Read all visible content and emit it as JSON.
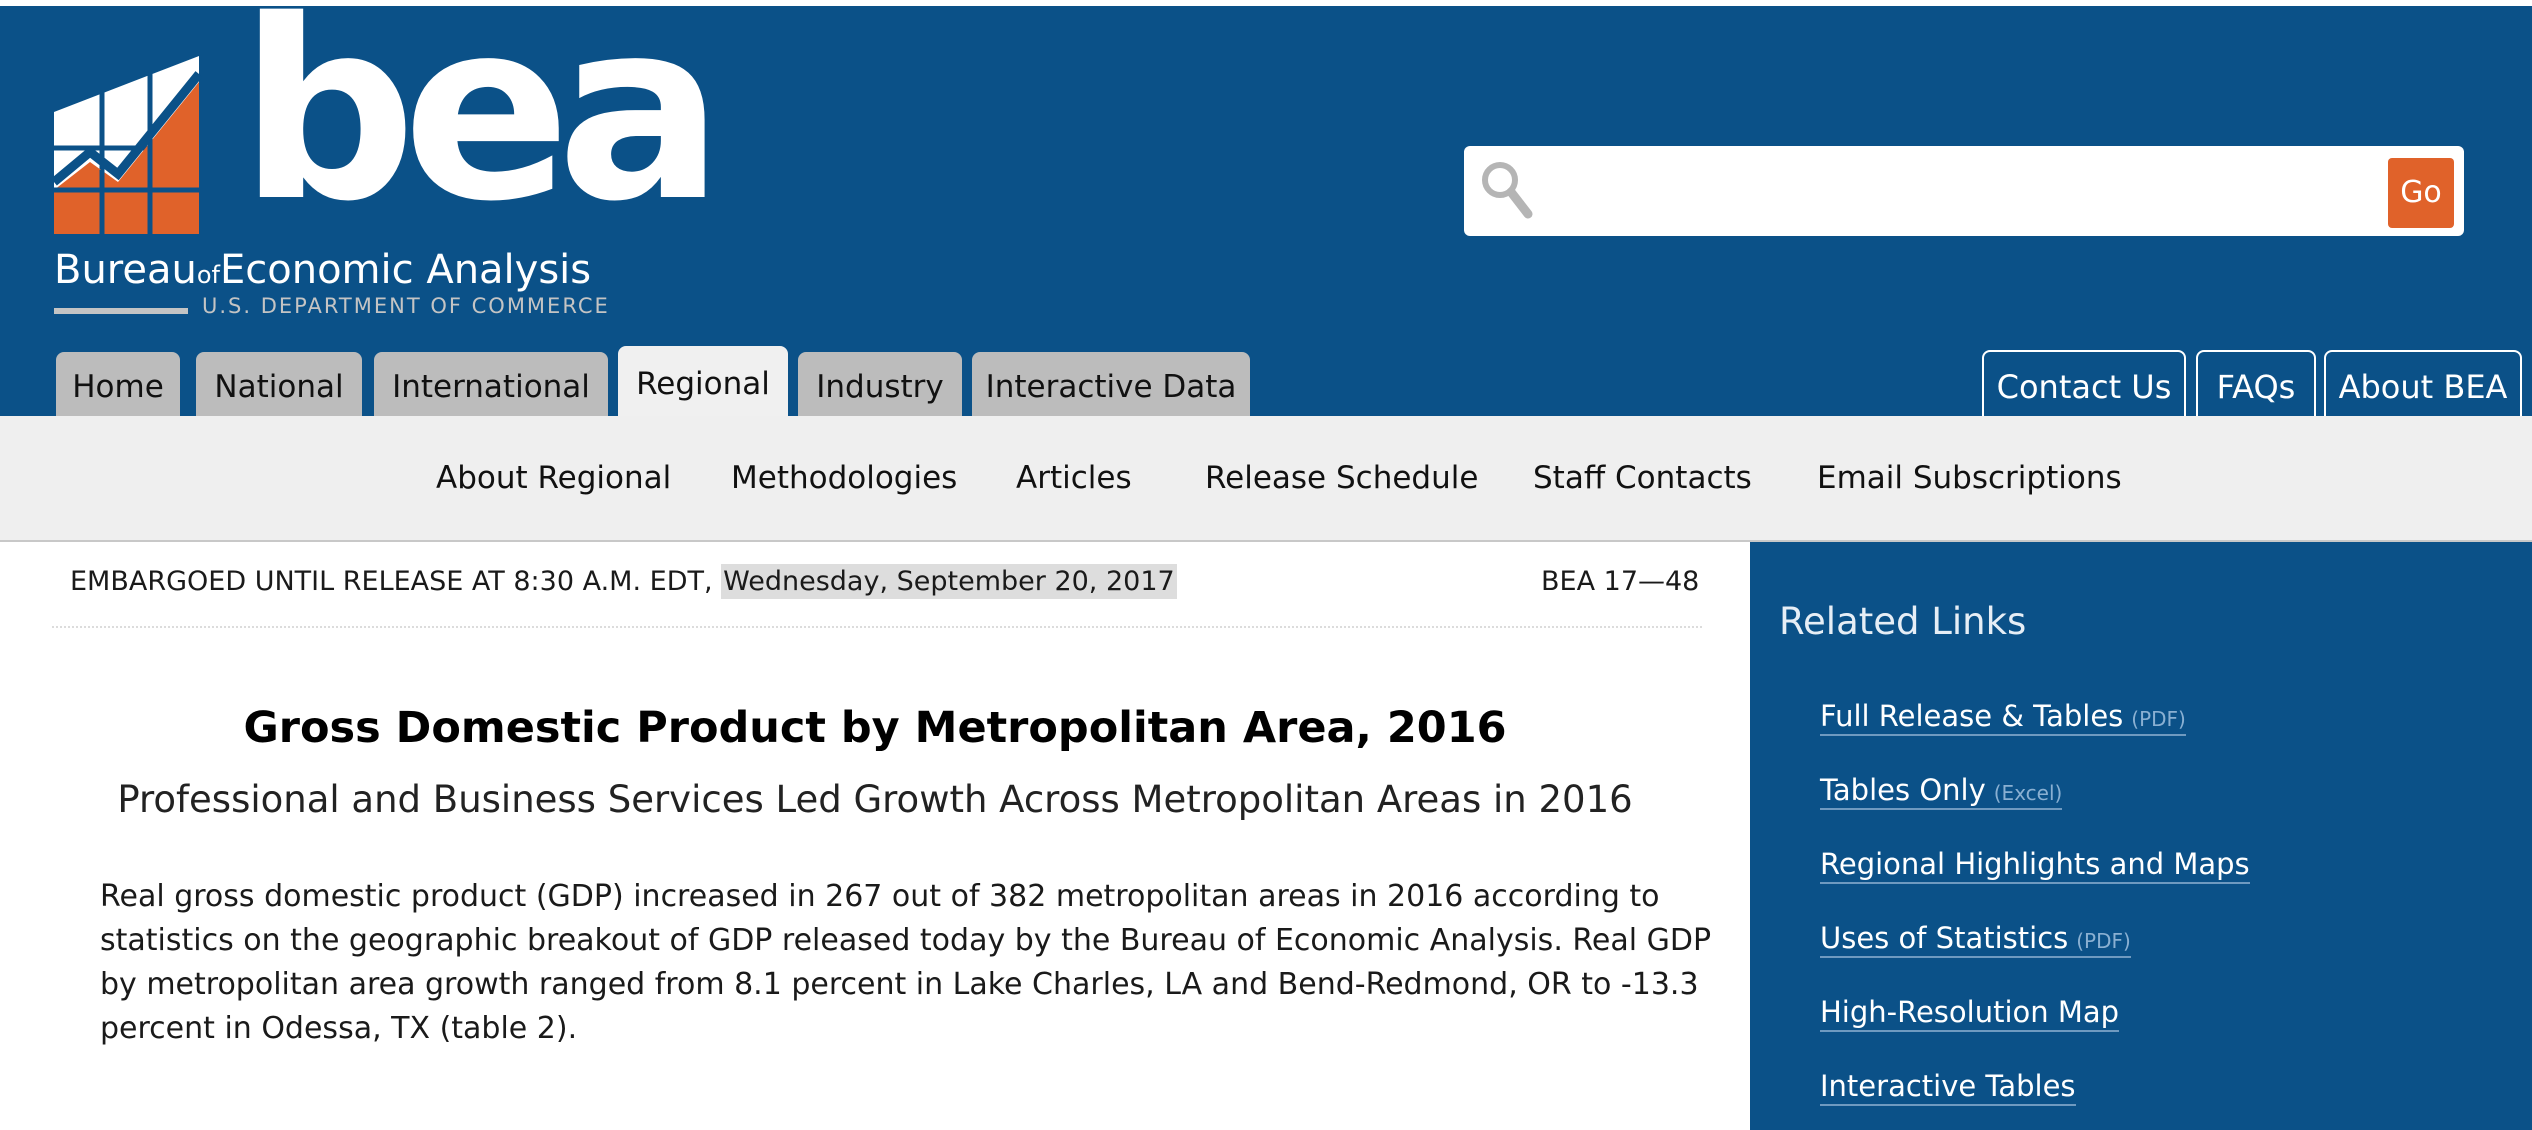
{
  "logo": {
    "wordmark": "bea",
    "line1_a": "Bureau",
    "line1_of": "of",
    "line1_b": "Economic Analysis",
    "line2": "U.S. DEPARTMENT OF COMMERCE"
  },
  "search": {
    "placeholder": "",
    "value": "",
    "go_label": "Go"
  },
  "main_tabs": [
    {
      "label": "Home"
    },
    {
      "label": "National"
    },
    {
      "label": "International"
    },
    {
      "label": "Regional",
      "active": true
    },
    {
      "label": "Industry"
    },
    {
      "label": "Interactive Data"
    }
  ],
  "utility_tabs": [
    {
      "label": "Contact Us"
    },
    {
      "label": "FAQs"
    },
    {
      "label": "About BEA"
    }
  ],
  "subnav": [
    {
      "label": "About Regional"
    },
    {
      "label": "Methodologies"
    },
    {
      "label": "Articles"
    },
    {
      "label": "Release Schedule"
    },
    {
      "label": "Staff Contacts"
    },
    {
      "label": "Email Subscriptions"
    }
  ],
  "release": {
    "embargo_prefix": "EMBARGOED UNTIL RELEASE AT 8:30 A.M. EDT, ",
    "embargo_date": "Wednesday, September 20, 2017",
    "number": "BEA 17—48"
  },
  "article": {
    "title": "Gross Domestic Product by Metropolitan Area, 2016",
    "subtitle": "Professional and Business Services Led Growth Across Metropolitan Areas in 2016",
    "paragraph": "Real gross domestic product (GDP) increased in 267 out of 382 metropolitan areas in 2016 according to statistics on the geographic breakout of GDP released today by the Bureau of Economic Analysis. Real GDP by metropolitan area growth ranged from 8.1 percent in Lake Charles, LA and Bend-Redmond, OR to -13.3 percent in Odessa, TX (table 2)."
  },
  "sidebar": {
    "heading": "Related Links",
    "links": [
      {
        "label": "Full Release & Tables",
        "tag": "(PDF)"
      },
      {
        "label": "Tables Only",
        "tag": "(Excel)"
      },
      {
        "label": "Regional Highlights and Maps",
        "tag": ""
      },
      {
        "label": "Uses of Statistics",
        "tag": "(PDF)"
      },
      {
        "label": "High-Resolution Map",
        "tag": ""
      },
      {
        "label": "Interactive Tables",
        "tag": ""
      }
    ]
  },
  "colors": {
    "header_blue": "#0b5188",
    "accent_orange": "#e0622a",
    "tab_gray": "#bcbcbc",
    "subnav_gray": "#efefef"
  }
}
